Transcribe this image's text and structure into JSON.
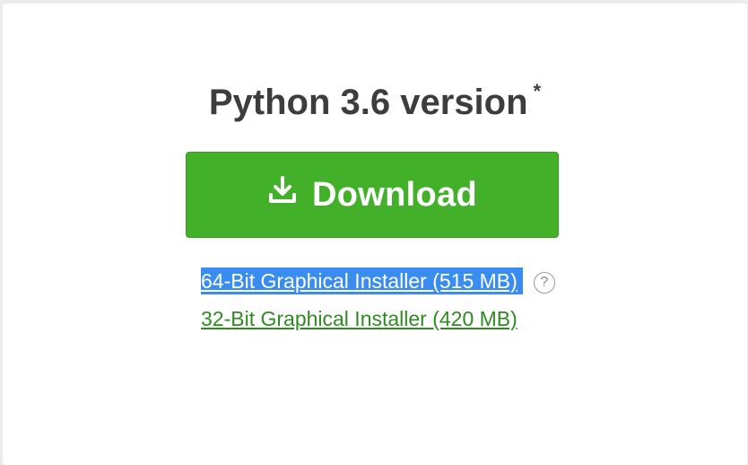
{
  "section": {
    "title": "Python 3.6 version",
    "title_marker": "*"
  },
  "download_button": {
    "label": "Download",
    "icon": "download-icon"
  },
  "installers": [
    {
      "label": "64-Bit Graphical Installer (515 MB)",
      "selected": true
    },
    {
      "label": "32-Bit Graphical Installer (420 MB)",
      "selected": false
    }
  ],
  "help": {
    "glyph": "?",
    "icon": "help-circle-icon"
  },
  "colors": {
    "button_green": "#43b02a",
    "link_green": "#2e8b1f",
    "selection_blue": "#3b8cf0",
    "title_gray": "#3d3d3d"
  }
}
